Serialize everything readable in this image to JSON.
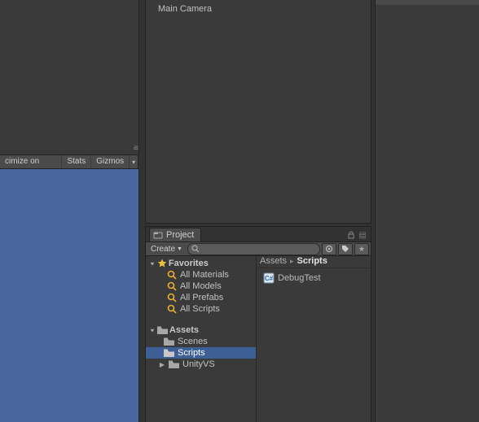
{
  "hierarchy": {
    "items": [
      {
        "label": "Main Camera"
      }
    ]
  },
  "game_toolbar": {
    "maximize_label": "cimize on Play",
    "stats_label": "Stats",
    "gizmos_label": "Gizmos"
  },
  "project": {
    "tab_label": "Project",
    "create_label": "Create",
    "search_placeholder": "",
    "favorites_header": "Favorites",
    "favorites": [
      {
        "label": "All Materials"
      },
      {
        "label": "All Models"
      },
      {
        "label": "All Prefabs"
      },
      {
        "label": "All Scripts"
      }
    ],
    "assets_header": "Assets",
    "folders": [
      {
        "label": "Scenes",
        "expandable": false,
        "selected": false
      },
      {
        "label": "Scripts",
        "expandable": false,
        "selected": true
      },
      {
        "label": "UnityVS",
        "expandable": true,
        "selected": false
      }
    ],
    "breadcrumb": {
      "root": "Assets",
      "current": "Scripts"
    },
    "files": [
      {
        "label": "DebugTest",
        "type": "cs"
      }
    ]
  }
}
